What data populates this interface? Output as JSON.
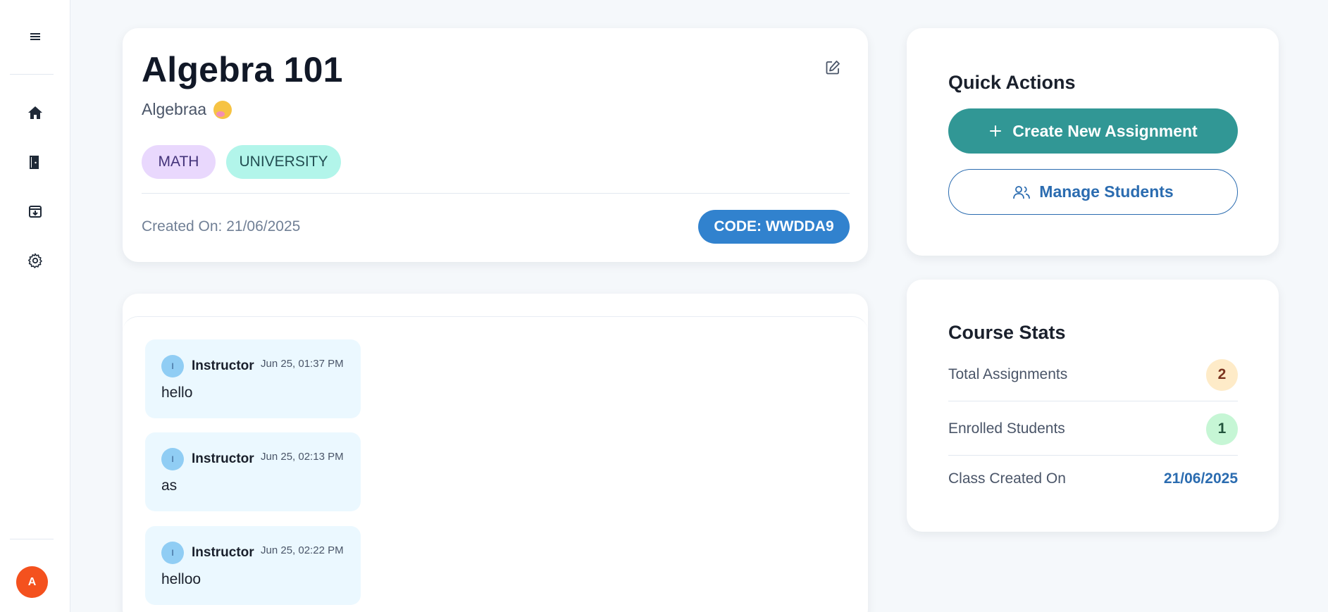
{
  "sidebar": {
    "icons": [
      "menu-icon",
      "home-icon",
      "door-exit-icon",
      "archive-icon",
      "settings-gear-icon"
    ],
    "user_initial": "A"
  },
  "class": {
    "title": "Algebra 101",
    "subtitle": "Algebraa",
    "subtitle_emoji": "🥱",
    "tags": [
      "MATH",
      "UNIVERSITY"
    ],
    "created_on": "Created On: 21/06/2025",
    "code": "CODE: WWDDA9"
  },
  "messages": [
    {
      "initial": "I",
      "author": "Instructor",
      "time": "Jun 25, 01:37 PM",
      "text": "hello"
    },
    {
      "initial": "I",
      "author": "Instructor",
      "time": "Jun 25, 02:13 PM",
      "text": "as"
    },
    {
      "initial": "I",
      "author": "Instructor",
      "time": "Jun 25, 02:22 PM",
      "text": "helloo"
    }
  ],
  "quick_actions": {
    "title": "Quick Actions",
    "create_label": "Create New Assignment",
    "manage_label": "Manage Students"
  },
  "stats": {
    "title": "Course Stats",
    "rows": [
      {
        "label": "Total Assignments",
        "value": "2",
        "badge_bg": "#feebc8",
        "badge_fg": "#7b341e"
      },
      {
        "label": "Enrolled Students",
        "value": "1",
        "badge_bg": "#c6f6d5",
        "badge_fg": "#22543d"
      },
      {
        "label": "Class Created On",
        "value": "21/06/2025"
      }
    ]
  },
  "colors": {
    "accent_teal": "#319795",
    "accent_blue": "#3182ce",
    "avatar_orange": "#f4511e"
  }
}
